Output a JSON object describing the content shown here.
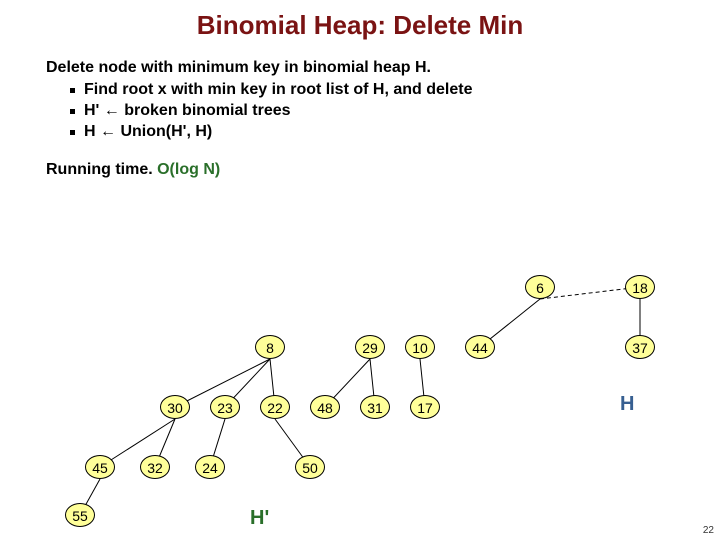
{
  "title": "Binomial Heap:  Delete Min",
  "text": {
    "intro": "Delete node with minimum key in binomial heap H.",
    "bullets": [
      "Find root x with min key in root list of H, and delete",
      "H' ←  broken binomial trees",
      "H  ←  Union(H', H)"
    ],
    "running_label": "Running time.  ",
    "running_value": "O(log N)"
  },
  "labels": {
    "H": "H",
    "Hprime": "H'"
  },
  "page_number": "22",
  "nodes": {
    "n6": "6",
    "n18": "18",
    "n8": "8",
    "n29": "29",
    "n10": "10",
    "n44": "44",
    "n37": "37",
    "n30": "30",
    "n23": "23",
    "n22": "22",
    "n48": "48",
    "n31": "31",
    "n17": "17",
    "n45": "45",
    "n32": "32",
    "n24": "24",
    "n50": "50",
    "n55": "55"
  },
  "chart_data": {
    "type": "diagram",
    "description": "Binomial heap delete-min illustration. Two heaps shown: H' (trees rooted at 8,29,10,6) and H (trees rooted at 44,18).",
    "edges": [
      [
        "6",
        "44"
      ],
      [
        "18",
        "37"
      ],
      [
        "6",
        "18",
        "dashed"
      ],
      [
        "8",
        "30"
      ],
      [
        "8",
        "23"
      ],
      [
        "8",
        "22"
      ],
      [
        "29",
        "48"
      ],
      [
        "29",
        "31"
      ],
      [
        "10",
        "17"
      ],
      [
        "30",
        "45"
      ],
      [
        "30",
        "32"
      ],
      [
        "23",
        "24"
      ],
      [
        "22",
        "50"
      ],
      [
        "45",
        "55"
      ]
    ]
  }
}
